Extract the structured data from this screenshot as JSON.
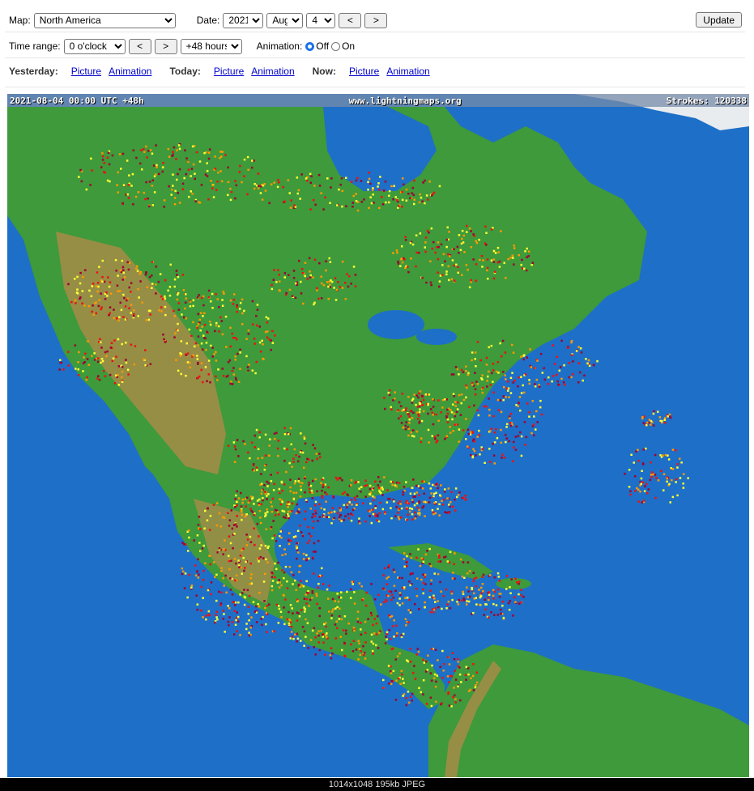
{
  "controls": {
    "map_label": "Map:",
    "map_value": "North America",
    "date_label": "Date:",
    "year": "2021",
    "month": "Aug",
    "day": "4",
    "prev": "<",
    "next": ">",
    "update": "Update",
    "time_range_label": "Time range:",
    "time_start": "0 o'clock",
    "duration": "+48 hours",
    "animation_label": "Animation:",
    "anim_off": "Off",
    "anim_on": "On"
  },
  "links": {
    "yesterday_label": "Yesterday:",
    "today_label": "Today:",
    "now_label": "Now:",
    "picture": "Picture",
    "animation": "Animation"
  },
  "map": {
    "timestamp": "2021-08-04 00:00 UTC +48h",
    "site": "www.lightningmaps.org",
    "strokes": "Strokes: 120338",
    "colors": {
      "ocean": "#1e6fc8",
      "land": "#3e9a3a",
      "highland": "#b48a4a",
      "strike_recent": "#ffff33",
      "strike_mid": "#ff9900",
      "strike_old": "#ee1111",
      "strike_oldest": "#a00030"
    }
  },
  "footer": "1014x1048 195kb JPEG"
}
